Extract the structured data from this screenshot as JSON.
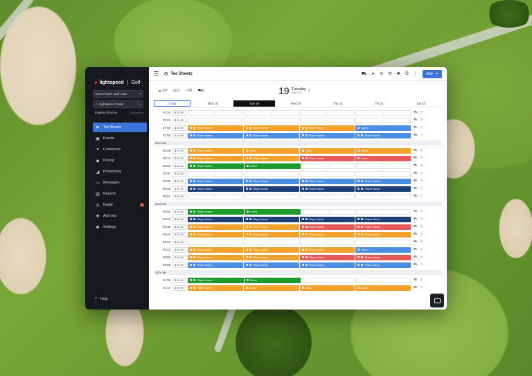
{
  "app": {
    "brand": "lightspeed",
    "product": "Golf"
  },
  "sidebar": {
    "club": "Deer Prairie Golf Club",
    "store": "Lightspeed Retail",
    "user": "Eugene Bourne",
    "role": "Manager",
    "items": [
      {
        "label": "Tee Sheets",
        "icon": "flag-icon",
        "active": true
      },
      {
        "label": "Events",
        "icon": "calendar-icon"
      },
      {
        "label": "Customers",
        "icon": "user-icon"
      },
      {
        "label": "Pricing",
        "icon": "tag-icon"
      },
      {
        "label": "Promotions",
        "icon": "megaphone-icon"
      },
      {
        "label": "Messages",
        "icon": "message-icon"
      },
      {
        "label": "Reports",
        "icon": "chart-icon"
      },
      {
        "label": "Radar",
        "icon": "radar-icon",
        "badge": "3"
      },
      {
        "label": "Add-ons",
        "icon": "puzzle-icon"
      },
      {
        "label": "Settings",
        "icon": "gear-icon"
      }
    ],
    "help": "Help"
  },
  "topbar": {
    "title": "Tee Sheets",
    "add_label": "Add"
  },
  "stats": {
    "temp": "24°",
    "tee_times": "11",
    "players": "32",
    "carts": "0"
  },
  "date": {
    "day": "19",
    "weekday": "Tuesday",
    "month_year": "May 2020"
  },
  "daytabs": [
    "Today",
    "Mon 18",
    "Tue 19",
    "Wed 20",
    "Thu 21",
    "Fri 22",
    "Sat 23"
  ],
  "rows": [
    {
      "time": "07:34",
      "price": "$ 24.99",
      "slots": [
        [
          "empty"
        ],
        [
          "empty"
        ],
        [
          "empty"
        ],
        [
          "empty"
        ]
      ]
    },
    {
      "time": "07:42",
      "price": "$ 24.99",
      "slots": [
        [
          "empty"
        ],
        [
          "empty"
        ],
        [
          "empty"
        ],
        [
          "empty"
        ]
      ]
    },
    {
      "time": "07:50",
      "price": "$ 24.99",
      "slots": [
        [
          "orange",
          "Player Name"
        ],
        [
          "orange",
          "Player Name"
        ],
        [
          "orange",
          "Player Name"
        ],
        [
          "blue",
          "Guest"
        ]
      ]
    },
    {
      "time": "07:58",
      "price": "$ 24.99",
      "slots": [
        [
          "blue",
          "Player Name"
        ],
        [
          "blue",
          "Player Name"
        ],
        [
          "blue",
          "Player Name"
        ],
        [
          "blue",
          "Player Name"
        ]
      ]
    },
    {
      "sep": "08:00 AM"
    },
    {
      "time": "08:06",
      "price": "$ 24.99",
      "slots": [
        [
          "orange",
          "Player Name"
        ],
        [
          "orange",
          "Guest"
        ],
        [
          "orange",
          "Guest"
        ],
        [
          "orange",
          "Guest"
        ]
      ]
    },
    {
      "time": "08:14",
      "price": "$ 24.99",
      "slots": [
        [
          "orange",
          "Player Name"
        ],
        [
          "orange",
          "Player Name"
        ],
        [
          "red",
          "Player Name"
        ],
        [
          "red",
          "Guest"
        ]
      ]
    },
    {
      "time": "08:22",
      "price": "$ 24.99",
      "slots": [
        [
          "green",
          "Player Name"
        ],
        [
          "green",
          "Guest"
        ],
        [
          "empty"
        ],
        [
          "empty"
        ]
      ]
    },
    {
      "time": "08:30",
      "price": "$ 24.99",
      "slots": [
        [
          "empty"
        ],
        [
          "empty"
        ],
        [
          "empty"
        ],
        [
          "empty"
        ]
      ]
    },
    {
      "time": "08:38",
      "price": "$ 24.99",
      "slots": [
        [
          "blue",
          "Player Name"
        ],
        [
          "blue",
          "Player Name"
        ],
        [
          "blue",
          "Player Name"
        ],
        [
          "blue",
          "Player Name"
        ]
      ]
    },
    {
      "time": "08:46",
      "price": "$ 24.99",
      "slots": [
        [
          "navy",
          "Player Name"
        ],
        [
          "navy",
          "Player Name"
        ],
        [
          "navy",
          "Player Name"
        ],
        [
          "navy",
          "Player Name"
        ]
      ]
    },
    {
      "time": "08:54",
      "price": "$ 24.99",
      "slots": [
        [
          "empty"
        ],
        [
          "empty"
        ],
        [
          "empty"
        ],
        [
          "empty"
        ]
      ]
    },
    {
      "sep": "09:00 AM"
    },
    {
      "time": "09:02",
      "price": "$ 24.99",
      "slots": [
        [
          "green",
          "Player Name"
        ],
        [
          "green",
          "Guest"
        ],
        [
          "empty"
        ],
        [
          "empty"
        ]
      ]
    },
    {
      "time": "09:10",
      "price": "$ 24.99",
      "slots": [
        [
          "navy",
          "Player Name"
        ],
        [
          "navy",
          "Player Name"
        ],
        [
          "navy",
          "Player Name"
        ],
        [
          "navy",
          "Player Name"
        ]
      ]
    },
    {
      "time": "09:18",
      "price": "$ 24.99",
      "slots": [
        [
          "orange",
          "Player Name"
        ],
        [
          "orange",
          "Player Name"
        ],
        [
          "red",
          "Player Name"
        ],
        [
          "red",
          "Player Name"
        ]
      ]
    },
    {
      "time": "09:26",
      "price": "$ 24.99",
      "slots": [
        [
          "orange",
          "Player Name"
        ],
        [
          "orange",
          "Player Name"
        ],
        [
          "orange",
          "Player Name"
        ],
        [
          "orange",
          "Player Name"
        ]
      ]
    },
    {
      "time": "09:34",
      "price": "$ 24.99",
      "slots": [
        [
          "empty"
        ],
        [
          "empty"
        ],
        [
          "empty"
        ],
        [
          "empty"
        ]
      ]
    },
    {
      "time": "09:42",
      "price": "$ 24.99",
      "slots": [
        [
          "orange",
          "Player Name"
        ],
        [
          "orange",
          "Player Name"
        ],
        [
          "orange",
          "Player Name"
        ],
        [
          "blue",
          "Guest"
        ]
      ]
    },
    {
      "time": "09:50",
      "price": "$ 24.99",
      "slots": [
        [
          "orange",
          "Player Name"
        ],
        [
          "orange",
          "Player Name"
        ],
        [
          "red",
          "Player Name"
        ],
        [
          "red",
          "Player Name"
        ]
      ]
    },
    {
      "time": "09:58",
      "price": "$ 24.99",
      "slots": [
        [
          "blue",
          "Player Name"
        ],
        [
          "blue",
          "Player Name"
        ],
        [
          "blue",
          "Player Name"
        ],
        [
          "blue",
          "Player Name"
        ]
      ]
    },
    {
      "sep": "10:00 AM"
    },
    {
      "time": "10:06",
      "price": "$ 24.99",
      "slots": [
        [
          "green",
          "Player Name"
        ],
        [
          "green",
          "Guest"
        ],
        [
          "empty"
        ],
        [
          "empty"
        ]
      ]
    },
    {
      "time": "10:14",
      "price": "$ 24.99",
      "slots": [
        [
          "orange",
          "Player Name"
        ],
        [
          "orange",
          "Guest"
        ],
        [
          "orange",
          "Guest"
        ],
        [
          "orange",
          "Guest"
        ]
      ]
    }
  ]
}
